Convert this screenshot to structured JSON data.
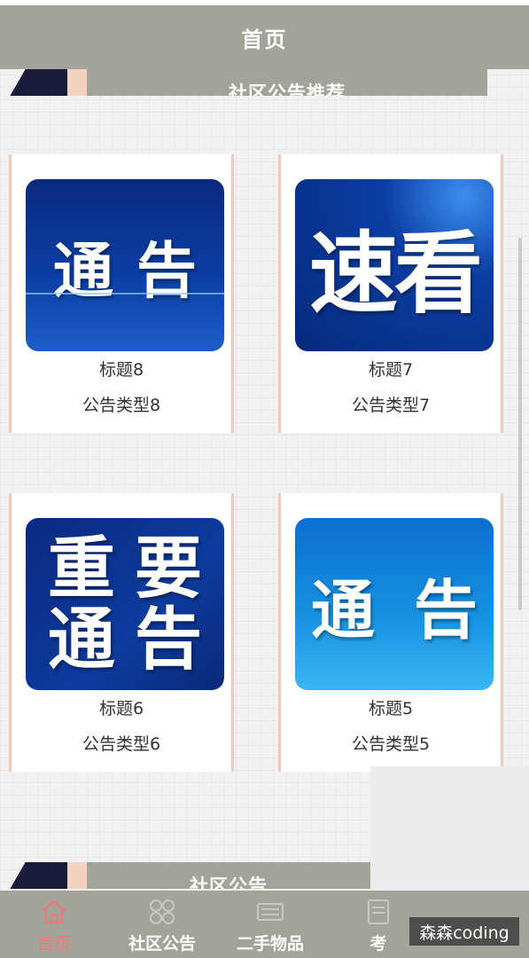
{
  "header": {
    "title": "首页"
  },
  "sections": {
    "recommend_label": "社区公告推荐",
    "announcements_label": "社区公告"
  },
  "cards": [
    {
      "image_text": "通告",
      "title": "标题8",
      "type": "公告类型8"
    },
    {
      "image_text": "速看",
      "title": "标题7",
      "type": "公告类型7"
    },
    {
      "image_text": "重要通告",
      "title": "标题6",
      "type": "公告类型6"
    },
    {
      "image_text": "通告",
      "title": "标题5",
      "type": "公告类型5"
    }
  ],
  "tabbar": {
    "items": [
      {
        "label": "首页",
        "icon": "home-icon",
        "active": true
      },
      {
        "label": "社区公告",
        "icon": "grid-icon",
        "active": false
      },
      {
        "label": "二手物品",
        "icon": "keyboard-icon",
        "active": false
      },
      {
        "label": "考",
        "icon": "document-icon",
        "active": false
      }
    ]
  },
  "watermark": "森森coding",
  "colors": {
    "header_bg": "#a3a499",
    "card_border": "#f3c9b4",
    "active_tab": "#e87a7a",
    "thumb_blue": "#0b3ea3"
  }
}
